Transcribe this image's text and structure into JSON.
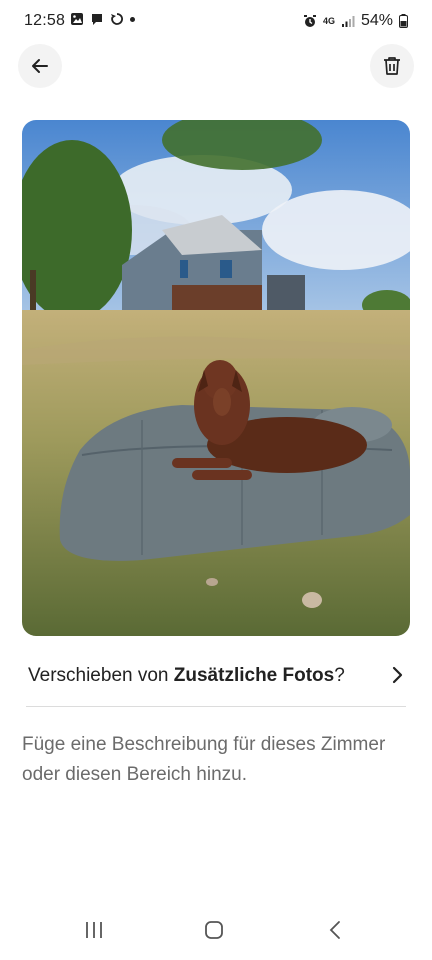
{
  "status_bar": {
    "time": "12:58",
    "network": "4G",
    "battery": "54%"
  },
  "header": {
    "back_icon": "arrow-left-icon",
    "delete_icon": "trash-icon"
  },
  "photo": {
    "subject": "dog-on-cushion-photo"
  },
  "move_action": {
    "prefix": "Verschieben von ",
    "target": "Zusätzliche Fotos",
    "suffix": "?"
  },
  "description_placeholder": "Füge eine Beschreibung für dieses Zimmer oder diesen Bereich hinzu.",
  "colors": {
    "text_primary": "#222222",
    "text_secondary": "#6b6b6b",
    "button_bg": "#f3f3f3",
    "divider": "#dcdcdc"
  }
}
